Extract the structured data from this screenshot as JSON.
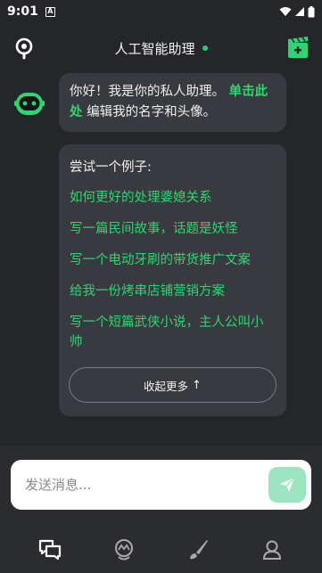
{
  "status_bar": {
    "time": "9:01",
    "indicator": "A"
  },
  "header": {
    "title": "人工智能助理"
  },
  "greeting": {
    "text_before": "你好！我是你的私人助理。",
    "link": "单击此处",
    "text_after": "编辑我的名字和头像。"
  },
  "examples": {
    "title": "尝试一个例子:",
    "items": [
      "如何更好的处理婆媳关系",
      "写一篇民间故事，话题是妖怪",
      "写一个电动牙刷的带货推广文案",
      "给我一份烤串店铺营销方案",
      "写一个短篇武侠小说，主人公叫小帅"
    ],
    "collapse_label": "收起更多",
    "collapse_arrow": "↑"
  },
  "composer": {
    "placeholder": "发送消息..."
  },
  "colors": {
    "accent": "#2ed573",
    "background": "#252629",
    "bubble": "#383a3f"
  },
  "tabbar": {
    "icons": [
      "chat-icon",
      "explore-icon",
      "brush-icon",
      "profile-icon"
    ]
  }
}
